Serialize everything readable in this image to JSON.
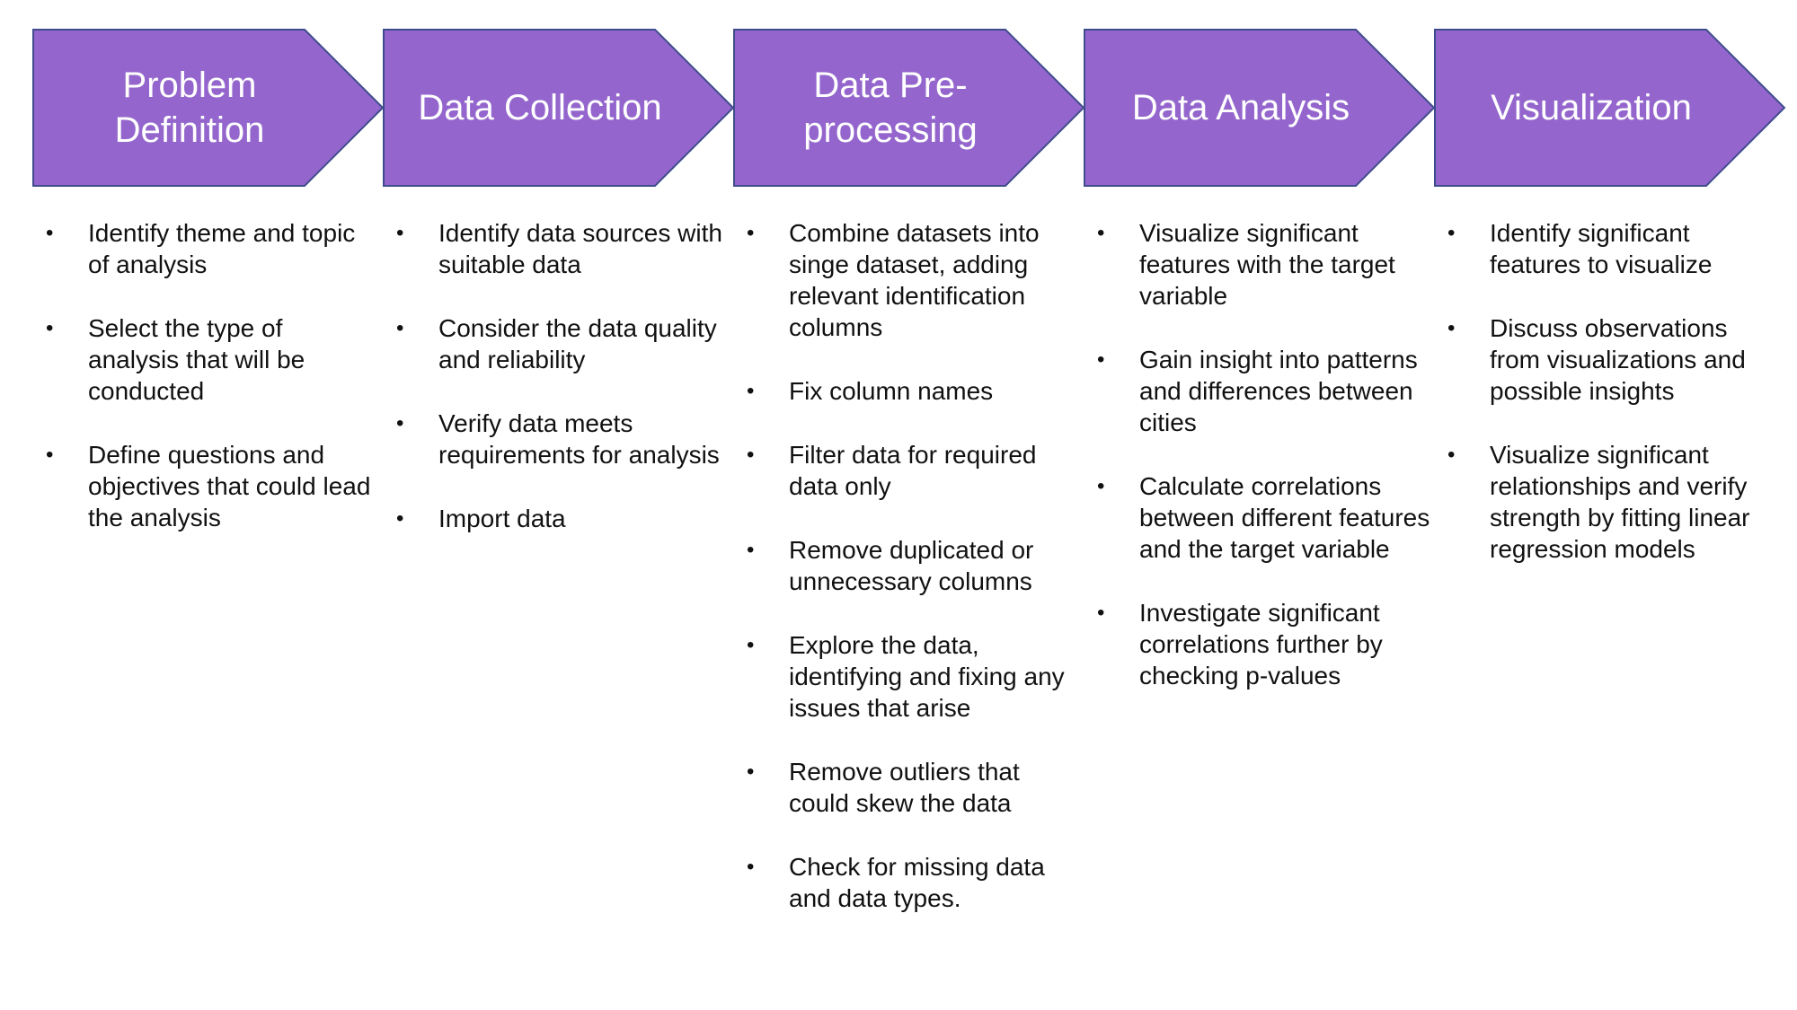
{
  "colors": {
    "chevron_fill": "#9466CD",
    "chevron_stroke": "#3F4C8C",
    "title_text": "#FFFFFF",
    "body_text": "#111111"
  },
  "stages": [
    {
      "title": "Problem Definition",
      "bullets": [
        "Identify theme and topic of analysis",
        "Select the type of analysis that will be conducted",
        "Define questions and objectives that could lead the analysis"
      ]
    },
    {
      "title": "Data Collection",
      "bullets": [
        "Identify data sources with suitable data",
        "Consider the data quality and reliability",
        "Verify data meets requirements for analysis",
        "Import data"
      ]
    },
    {
      "title": "Data Pre-processing",
      "bullets": [
        "Combine datasets into singe dataset, adding relevant identification columns",
        "Fix column names",
        "Filter data for required data only",
        "Remove duplicated or unnecessary columns",
        "Explore the data, identifying and fixing any issues that arise",
        "Remove outliers that could skew the data",
        "Check for missing data and data types."
      ]
    },
    {
      "title": "Data Analysis",
      "bullets": [
        "Visualize significant features with the target variable",
        "Gain insight into patterns and differences between cities",
        "Calculate correlations between different features and the target variable",
        "Investigate significant correlations further by checking p-values"
      ]
    },
    {
      "title": "Visualization",
      "bullets": [
        "Identify significant features to visualize",
        "Discuss observations from visualizations and possible insights",
        "Visualize significant relationships and verify strength by fitting linear regression models"
      ]
    }
  ]
}
